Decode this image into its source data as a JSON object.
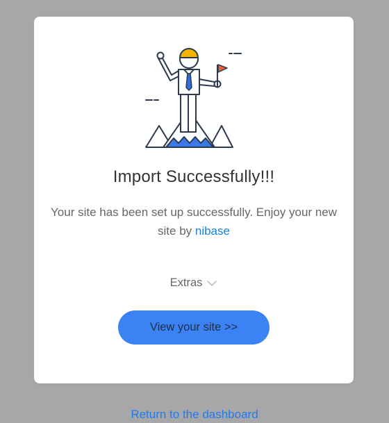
{
  "dialog": {
    "title": "Import Successfully!!!",
    "description_prefix": "Your site has been set up successfully. Enjoy your new site by ",
    "brand_link": "nibase",
    "extras_label": "Extras",
    "extras_icon": "chevron-down-icon",
    "view_button": "View your site >>",
    "illustration": "success-person-on-mountain-illustration"
  },
  "footer": {
    "return_link": "Return to the dashboard"
  },
  "colors": {
    "accent": "#3b82f5",
    "link": "#1a80e0",
    "backdrop": "#a7a7a7",
    "flag": "#e8633d",
    "helmet": "#f5b301"
  }
}
